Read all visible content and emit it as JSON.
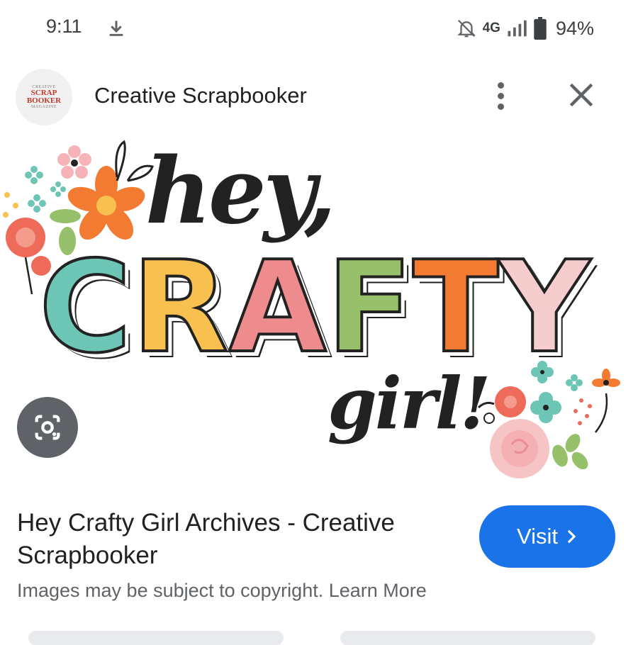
{
  "status_bar": {
    "time": "9:11",
    "network": "4G",
    "battery": "94%",
    "icons": [
      "download-icon",
      "notifications-off-icon",
      "signal-icon",
      "battery-icon"
    ]
  },
  "header": {
    "site_name": "Creative Scrapbooker",
    "logo_text": {
      "top": "CREATIVE",
      "line1": "SCRAP",
      "line2": "BOOKER",
      "bottom": "MAGAZINE"
    },
    "more_icon": "more-vert-icon",
    "close_icon": "close-icon"
  },
  "image": {
    "alt_words": {
      "hey": "hey,",
      "crafty": [
        "C",
        "R",
        "A",
        "F",
        "T",
        "Y"
      ],
      "girl": "girl!"
    },
    "letter_colors": [
      "#6cc5b5",
      "#f7c04f",
      "#ee8b8c",
      "#97c06a",
      "#f27a31",
      "#f6cdcd"
    ],
    "lens_icon": "google-lens-icon"
  },
  "result": {
    "title": "Hey Crafty Girl Archives - Creative Scrapbooker",
    "visit_label": "Visit",
    "visit_icon": "chevron-right-icon",
    "copyright_text": "Images may be subject to copyright.",
    "learn_more": "Learn More"
  },
  "colors": {
    "accent": "#1a73e8",
    "text": "#202124",
    "secondary": "#5f6368"
  }
}
